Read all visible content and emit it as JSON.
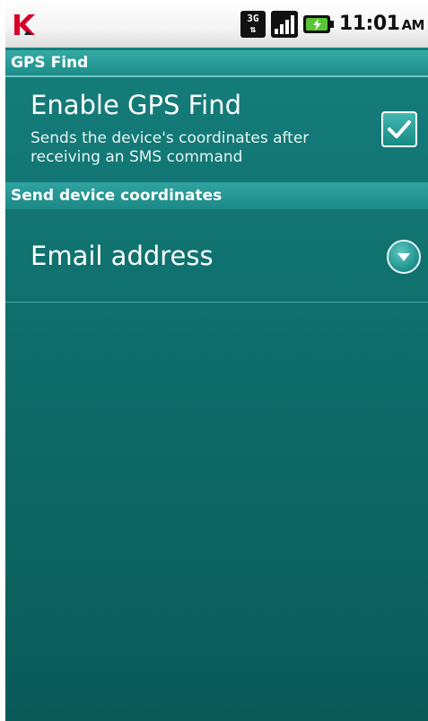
{
  "status_bar": {
    "app_icon": "kaspersky-k-icon",
    "network": "3G",
    "time": "11:01",
    "ampm": "AM"
  },
  "sections": {
    "gps_find": {
      "header": "GPS Find",
      "enable": {
        "title": "Enable GPS Find",
        "summary": "Sends the device's coordinates after receiving an SMS command",
        "checked": true
      }
    },
    "send_coords": {
      "header": "Send device coordinates",
      "email": {
        "title": "Email address",
        "icon": "chevron-down-icon"
      }
    }
  },
  "colors": {
    "background": "#0f6f6c",
    "header": "#1d8d89",
    "accent": "#43b8b2"
  }
}
